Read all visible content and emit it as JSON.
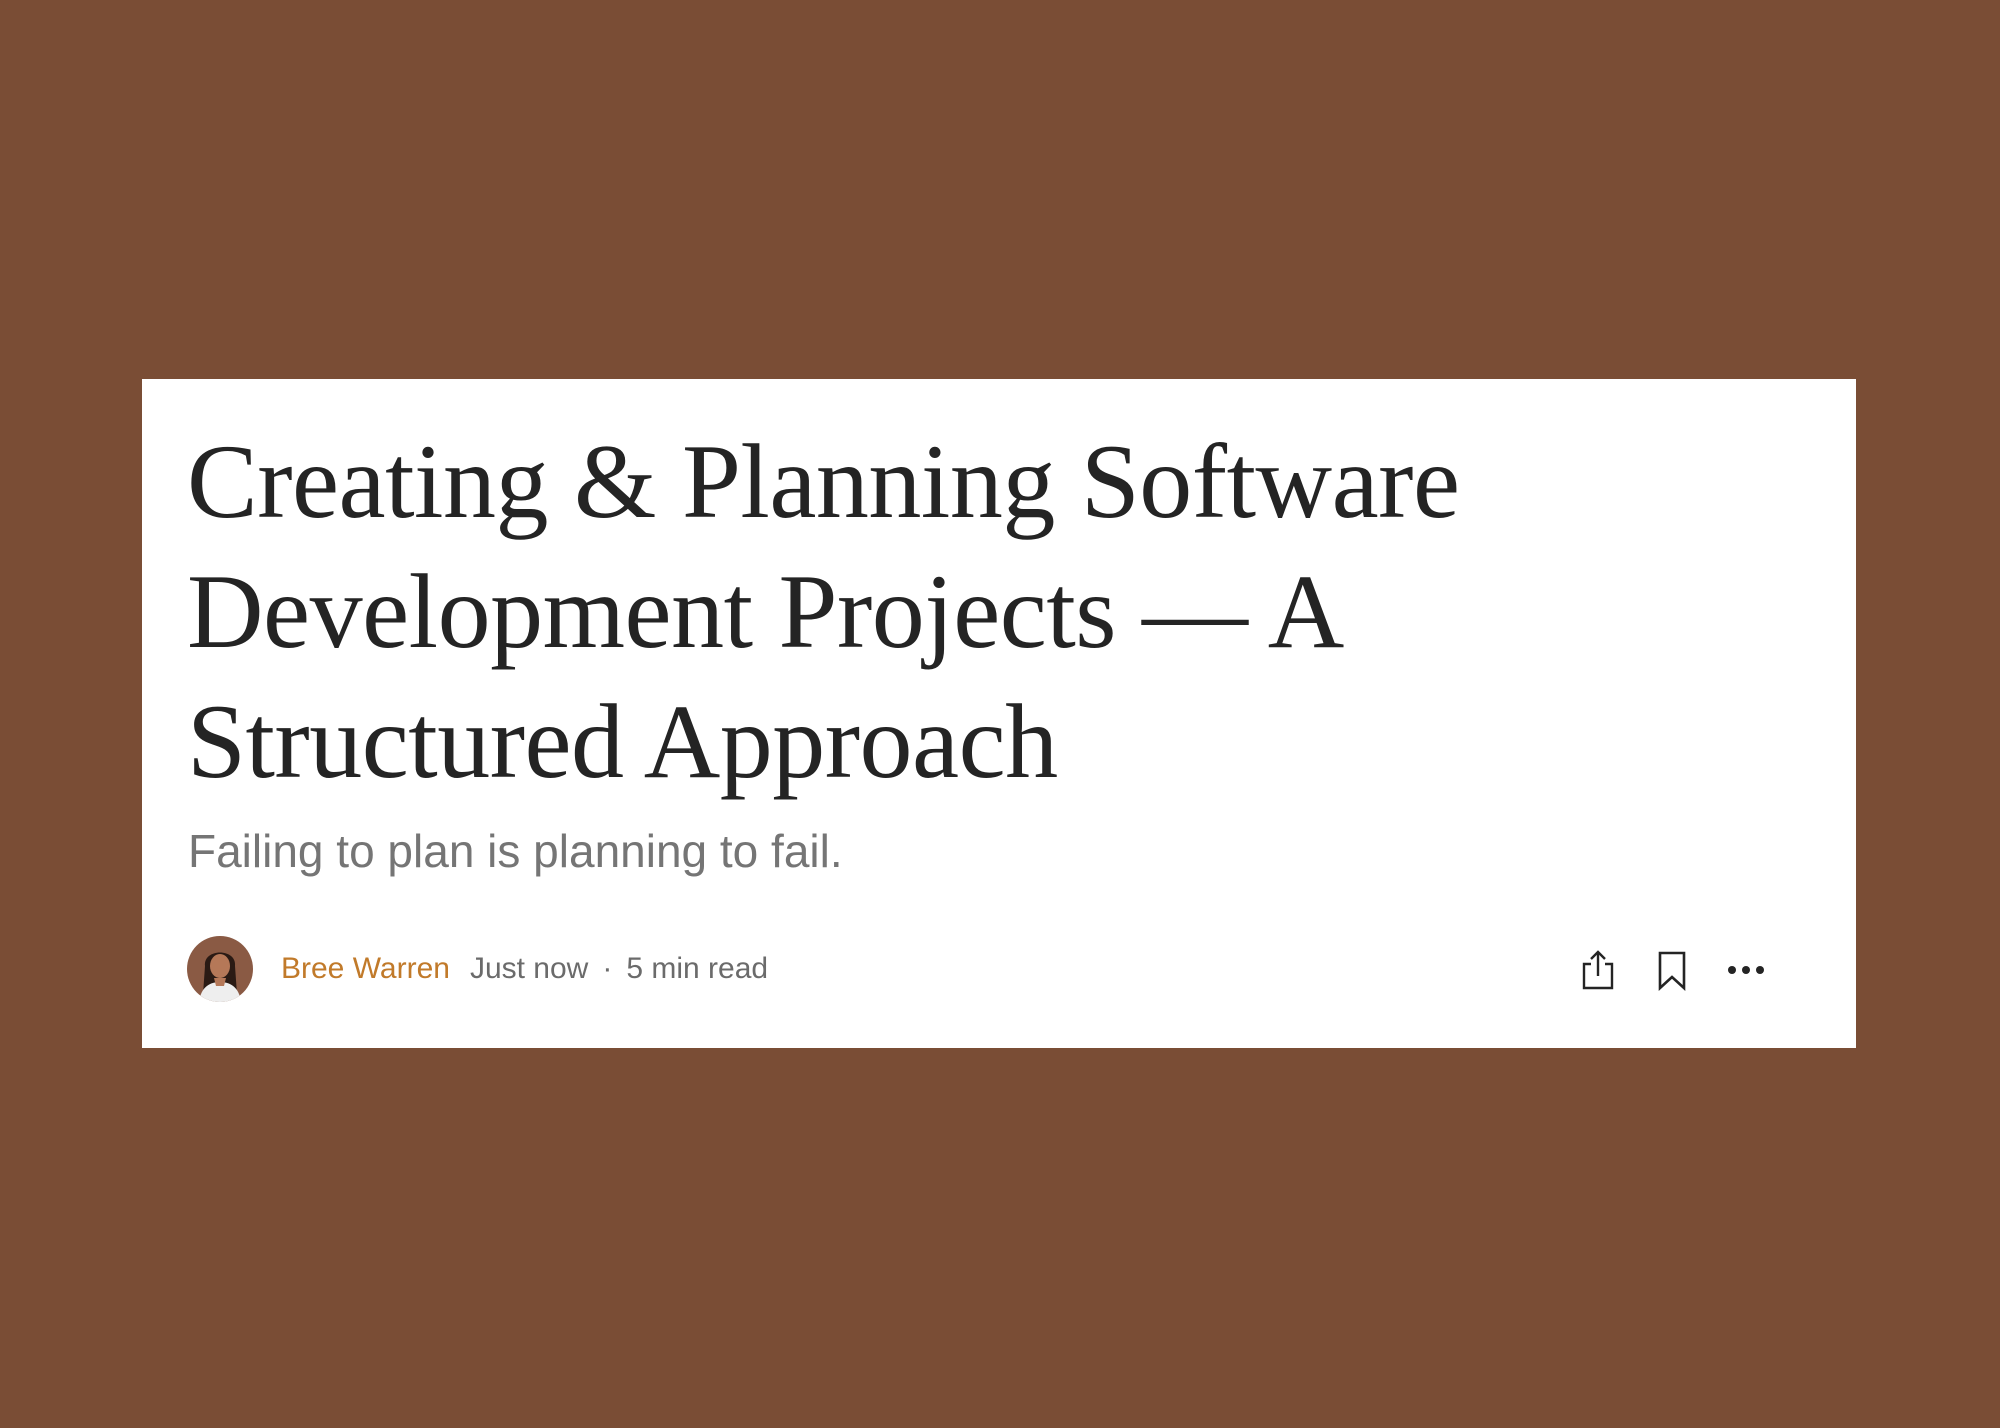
{
  "article": {
    "title": "Creating & Planning Software Development Projects — A Structured Approach",
    "subtitle": "Failing to plan is planning to fail.",
    "author": "Bree Warren",
    "published": "Just now",
    "separator": "·",
    "read_time": "5 min read"
  },
  "actions": {
    "share_icon": "share-icon",
    "bookmark_icon": "bookmark-icon",
    "more_icon": "more-icon"
  },
  "colors": {
    "background": "#7a4d35",
    "card": "#ffffff",
    "title": "#242424",
    "subtitle": "#757575",
    "author": "#c17a2a",
    "meta": "#6b6b6b"
  }
}
